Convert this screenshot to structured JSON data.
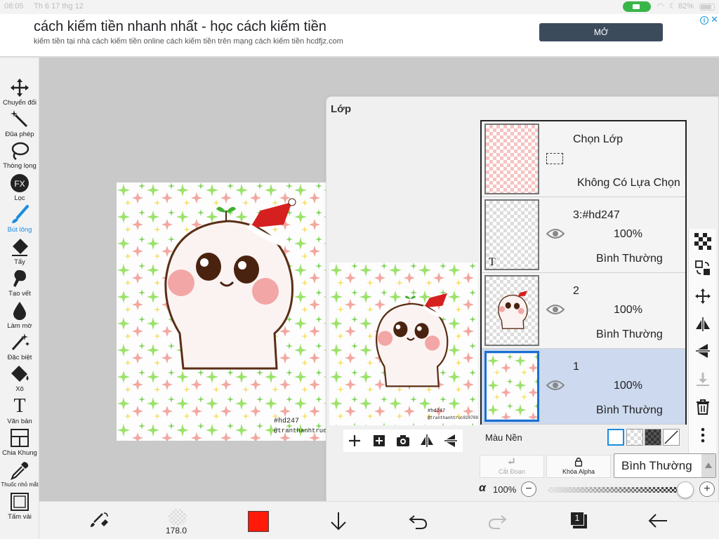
{
  "status_bar": {
    "time": "08:05",
    "date": "Th 6 17 thg 12",
    "battery": "82%"
  },
  "ad": {
    "title": "cách kiếm tiền nhanh nhất - học cách kiếm tiền",
    "subtitle": "kiếm tiền tại nhà cách kiếm tiền online cách kiếm tiền trên mạng cách kiếm tiền hcdfjz.com",
    "button": "MỞ",
    "info_icon": "info-icon",
    "close_glyph": "✕"
  },
  "toolbar": {
    "tools": [
      {
        "label": "Chuyển đổi",
        "icon": "move-icon"
      },
      {
        "label": "Đũa phép",
        "icon": "magic-wand-icon"
      },
      {
        "label": "Thòng lọng",
        "icon": "lasso-icon"
      },
      {
        "label": "Lọc",
        "icon": "fx-icon"
      },
      {
        "label": "Bút lông",
        "icon": "brush-icon",
        "active": true
      },
      {
        "label": "Tẩy",
        "icon": "eraser-icon"
      },
      {
        "label": "Tạo vết",
        "icon": "smudge-icon"
      },
      {
        "label": "Làm mờ",
        "icon": "blur-icon"
      },
      {
        "label": "Đặc biệt",
        "icon": "special-icon"
      },
      {
        "label": "Xô",
        "icon": "bucket-icon"
      },
      {
        "label": "Văn bản",
        "icon": "text-icon"
      },
      {
        "label": "Chia Khung",
        "icon": "frame-divider-icon"
      },
      {
        "label": "Thuốc nhỏ mắt",
        "icon": "eyedropper-icon"
      },
      {
        "label": "Tấm vải",
        "icon": "canvas-icon"
      }
    ],
    "fx_text": "FX",
    "text_glyph": "T"
  },
  "artwork": {
    "watermark_tag": "#hd247",
    "watermark_user": "@tranthanhtruc020709"
  },
  "layer_panel": {
    "title": "Lớp",
    "selection_layer": {
      "title": "Chọn Lớp",
      "status": "Không Có Lựa Chọn"
    },
    "layers": [
      {
        "name": "3:#hd247",
        "opacity": "100%",
        "mode": "Bình Thường",
        "selected": false,
        "thumb_glyph": "T"
      },
      {
        "name": "2",
        "opacity": "100%",
        "mode": "Bình Thường",
        "selected": false
      },
      {
        "name": "1",
        "opacity": "100%",
        "mode": "Bình Thường",
        "selected": true
      }
    ],
    "background_label": "Màu Nền",
    "clip_button": "Cắt Đoạn",
    "alpha_lock_button": "Khóa Alpha",
    "blend_mode": "Bình Thường",
    "alpha_symbol": "α",
    "alpha_value": "100%",
    "alpha_fraction": 1.0,
    "minus": "−",
    "plus": "+",
    "preview_tools": [
      "add-layer-icon",
      "add-layer-square-icon",
      "camera-icon",
      "flip-horizontal-icon",
      "flip-vertical-icon"
    ],
    "right_icons": [
      "checkerboard-icon",
      "transform-icon",
      "move-icon",
      "flip-horizontal-icon",
      "flip-vertical-icon",
      "merge-down-icon",
      "trash-icon",
      "more-icon"
    ]
  },
  "bottom_bar": {
    "brush_size": "178.0",
    "color": "#ff1a0a",
    "page_count": "1"
  },
  "colors": {
    "accent": "#1a8ddf",
    "selected_layer": "#ccd9ee",
    "ad_button": "#3c4b5c",
    "record": "#39b54a"
  }
}
